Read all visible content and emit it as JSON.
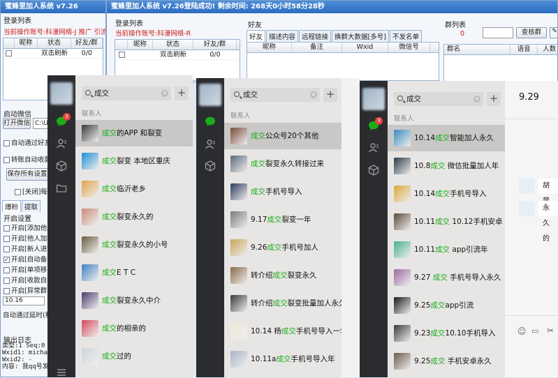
{
  "tool_win1": {
    "title": "蜜蜂里加人系统 v7.26",
    "login_list_label": "登录列表",
    "account_prefix": "当前操作账号:",
    "account_value": "科漫网络-J 推广 引流 爽",
    "cols": [
      "",
      "昵称",
      "状态",
      "好友/群"
    ],
    "row": {
      "status": "双击刷新",
      "count": "0/0"
    },
    "auto_label": "启动微信",
    "open_btn": "打开微信",
    "path_value": "C:\\U",
    "auto_friend": "自动通过好友",
    "transfer": "转账自动收款",
    "save_btn": "保存所有设置",
    "close_every": "[关闭]每",
    "tabs": [
      "爆粉",
      "提取"
    ],
    "switch_label": "开启设置",
    "opts": [
      "开启[添加他人",
      "开启[他人加我",
      "开启[新人进群",
      "开启[自动备注",
      "开启[单项移注",
      "开启[收款自动",
      "开启[异常群自"
    ],
    "opts_checked": [
      false,
      false,
      false,
      true,
      false,
      false,
      false
    ],
    "delay_value": "10.16",
    "delay_label": "自动通过延时(秒",
    "log_label": "输出日志",
    "log_lines": [
      "类型:1  Seq:0",
      "Wxid1: michaelle",
      "Wxid2: -",
      "内容: 我qq号发给"
    ]
  },
  "tool_win2": {
    "title": "蜜蜂里加人系统 v7.26登陆成功! 剩余时间: 268天0小时58分28秒",
    "login_list_label": "登录列表",
    "account_prefix": "当前操作账号:",
    "account_value": "科漫网络-R",
    "cols": [
      "",
      "昵称",
      "状态",
      "好友/群"
    ],
    "row": {
      "status": "双击刷新",
      "count": "0/0"
    },
    "friends_label": "好友",
    "tabs": [
      "好友",
      "描述内容",
      "远程链接",
      "换群大数据[多号]",
      "不发名单"
    ],
    "friend_cols": [
      "昵称",
      "备注",
      "Wxid",
      "微信号"
    ],
    "group_label": "群列表",
    "group_count": "0",
    "group_count2": "0",
    "group_btn": "查核群",
    "group_cols": [
      "群名",
      "语音",
      "人数"
    ]
  },
  "panel1": {
    "search_value": "成交",
    "section": "联系人",
    "badge": "3",
    "contacts": [
      {
        "pre": "",
        "hl": "成交",
        "post": "的APP 和裂变",
        "color": "#3a3a3a"
      },
      {
        "pre": "",
        "hl": "成交",
        "post": "裂变 本地区重庆",
        "color": "#1c8fd6"
      },
      {
        "pre": "",
        "hl": "成交",
        "post": "临沂老乡",
        "color": "#e0a34a"
      },
      {
        "pre": "",
        "hl": "成交",
        "post": "裂变永久的",
        "color": "#c98b7a"
      },
      {
        "pre": "",
        "hl": "成交",
        "post": "裂变永久的小号",
        "color": "#6a5b3e"
      },
      {
        "pre": "",
        "hl": "成交",
        "post": "E T C",
        "color": "#3f7fbf"
      },
      {
        "pre": "",
        "hl": "成交",
        "post": "裂变永久中介",
        "color": "#4a3c6a"
      },
      {
        "pre": "",
        "hl": "成交",
        "post": "的相亲的",
        "color": "#d44a5a"
      },
      {
        "pre": "",
        "hl": "成交",
        "post": "过的",
        "color": "#cfd4d8"
      }
    ]
  },
  "panel2": {
    "search_value": "成交",
    "section": "联系人",
    "contacts": [
      {
        "pre": "",
        "hl": "成交",
        "post": "公众号20个其他",
        "color": "#7a4a3a"
      },
      {
        "pre": "",
        "hl": "成交",
        "post": "裂变永久转接过来",
        "color": "#5a6b7a"
      },
      {
        "pre": "",
        "hl": "成交",
        "post": "手机号导入",
        "color": "#2d3a5a"
      },
      {
        "pre": "9.17",
        "hl": "成交",
        "post": "裂变一年",
        "color": "#7a7a7a"
      },
      {
        "pre": "9.26",
        "hl": "成交",
        "post": "手机号加人",
        "color": "#c9a45a"
      },
      {
        "pre": "转介绍",
        "hl": "成交",
        "post": "裂变永久",
        "color": "#8a6a4a"
      },
      {
        "pre": "转介绍",
        "hl": "成交",
        "post": "裂变批量加人永久",
        "color": "#3a3a3a"
      },
      {
        "pre": "10.14 杨",
        "hl": "成交",
        "post": "手机号导入一年...",
        "color": "#f0e6d8"
      },
      {
        "pre": "10.11a",
        "hl": "成交",
        "post": "手机号导入年",
        "color": "#a8b4c8"
      }
    ]
  },
  "panel3": {
    "search_value": "成交",
    "section": "联系人",
    "badge": "3",
    "chat_header": "9.29",
    "chat_msgs": [
      "胡斐",
      "永久的"
    ],
    "contacts": [
      {
        "pre": "10.14",
        "hl": "成交",
        "post": "智能加人永久",
        "color": "#3a8ac0"
      },
      {
        "pre": "10.8",
        "hl": "成交",
        "post": " 微信批量加人年",
        "color": "#2a3a4a"
      },
      {
        "pre": "10.14",
        "hl": "成交",
        "post": "手机号导入",
        "color": "#d8a83a"
      },
      {
        "pre": "10.11",
        "hl": "成交",
        "post": " 10.12手机安卓 年",
        "color": "#5a4a3a"
      },
      {
        "pre": "10.11",
        "hl": "成交",
        "post": " app引流年",
        "color": "#4ab08a"
      },
      {
        "pre": "9.27 ",
        "hl": "成交",
        "post": " 手机号导入永久",
        "color": "#9a6aa0"
      },
      {
        "pre": "9.25",
        "hl": "成交",
        "post": "app引流",
        "color": "#1a1a1a"
      },
      {
        "pre": "9.23",
        "hl": "成交",
        "post": "10.10手机导入",
        "color": "#3a3a3a"
      },
      {
        "pre": "9.25",
        "hl": "成交",
        "post": " 手机安卓永久",
        "color": "#6a5a4a"
      }
    ]
  }
}
